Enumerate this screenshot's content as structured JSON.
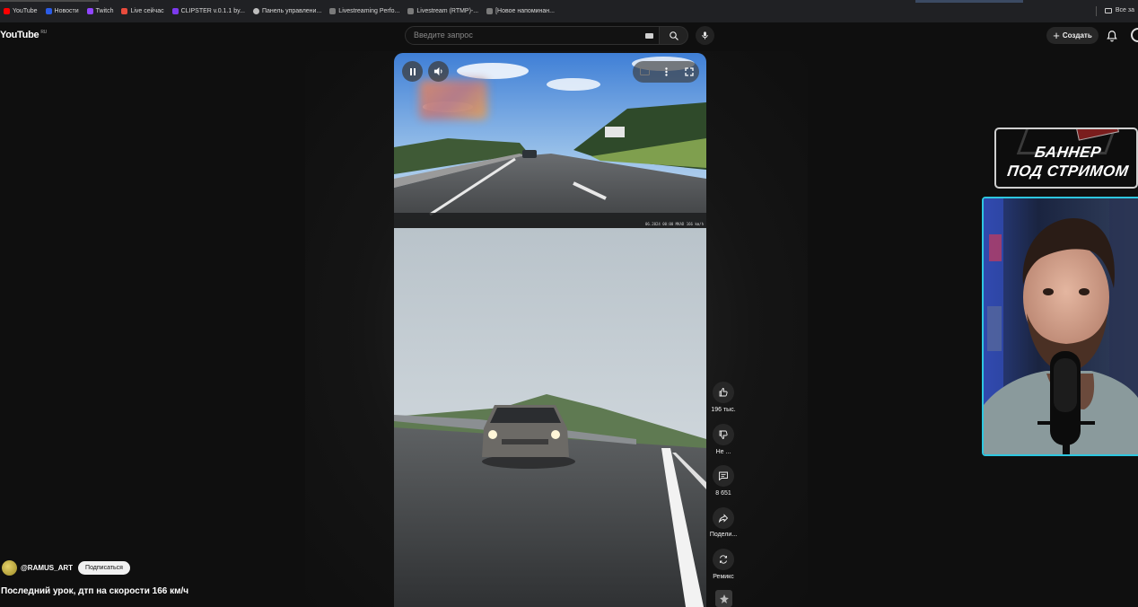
{
  "bookmarks": {
    "items": [
      {
        "label": "YouTube",
        "color": "#ff0000"
      },
      {
        "label": "Новости",
        "color": "#2b5ce6"
      },
      {
        "label": "Twitch",
        "color": "#9146ff"
      },
      {
        "label": "Live сейчас",
        "color": "#e84b3c"
      },
      {
        "label": "CLIPSTER v.0.1.1 by...",
        "color": "#7c3aed"
      },
      {
        "label": "Панель управлени...",
        "color": "#bdbdbd"
      },
      {
        "label": "Livestreaming Perfo...",
        "color": "#7a7a7a"
      },
      {
        "label": "Livestream (RTMP)-...",
        "color": "#7a7a7a"
      },
      {
        "label": "[Новое напоминан...",
        "color": "#7a7a7a"
      }
    ],
    "all_bookmarks": "Все за"
  },
  "header": {
    "logo": "YouTube",
    "region": "RU",
    "search_placeholder": "Введите запрос",
    "create_label": "Создать"
  },
  "actions": {
    "likes": "196 тыс.",
    "dislike": "Не ...",
    "comments": "8 651",
    "share": "Подели...",
    "remix": "Ремикс"
  },
  "channel": {
    "handle": "@RAMUS_ART",
    "subscribe": "Подписаться"
  },
  "video": {
    "title": "Последний урок, дтп на скорости 166 км/ч",
    "dashcam_stamp": "06.2024 00:00 MKAD 166 km/h"
  },
  "overlay": {
    "banner_line1": "БАННЕР",
    "banner_line2": "ПОД СТРИМОМ"
  }
}
